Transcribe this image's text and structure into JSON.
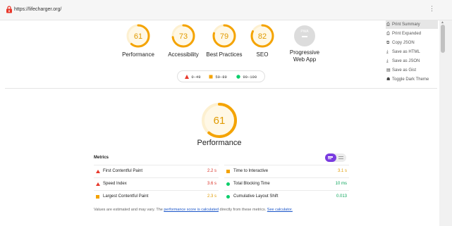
{
  "browser": {
    "url": "https://lifecharger.org/",
    "menu_dots": "⋮"
  },
  "colors": {
    "fail": "#e8382b",
    "average": "#f4a300",
    "pass": "#0cce6b",
    "average_text": "#e09a00",
    "pass_text": "#0ca55b",
    "fail_text": "#d93025",
    "toggle_accent": "#7a3ce0"
  },
  "categories": [
    {
      "label": "Performance",
      "score": 61
    },
    {
      "label": "Accessibility",
      "score": 73
    },
    {
      "label": "Best Practices",
      "score": 79
    },
    {
      "label": "SEO",
      "score": 82
    }
  ],
  "pwa": {
    "badge": "PWA",
    "label_line1": "Progressive",
    "label_line2": "Web App"
  },
  "legend": [
    {
      "icon": "fail-triangle-icon",
      "range": "0–49"
    },
    {
      "icon": "average-square-icon",
      "range": "50–89"
    },
    {
      "icon": "pass-circle-icon",
      "range": "90–100"
    }
  ],
  "main": {
    "score": 61,
    "title": "Performance"
  },
  "metrics": {
    "title": "Metrics",
    "items": [
      {
        "name": "First Contentful Paint",
        "value": "2.2 s",
        "rating": "fail"
      },
      {
        "name": "Time to Interactive",
        "value": "3.1 s",
        "rating": "average"
      },
      {
        "name": "Speed Index",
        "value": "3.6 s",
        "rating": "fail"
      },
      {
        "name": "Total Blocking Time",
        "value": "10 ms",
        "rating": "pass"
      },
      {
        "name": "Largest Contentful Paint",
        "value": "2.3 s",
        "rating": "average"
      },
      {
        "name": "Cumulative Layout Shift",
        "value": "0.013",
        "rating": "pass"
      }
    ]
  },
  "footnote": {
    "prefix": "Values are estimated and may vary. The ",
    "link1": "performance score is calculated",
    "middle": " directly from these metrics. ",
    "link2": "See calculator."
  },
  "menu": {
    "items": [
      {
        "icon": "print-icon",
        "glyph": "⎙",
        "label": "Print Summary"
      },
      {
        "icon": "print-icon",
        "glyph": "⎙",
        "label": "Print Expanded"
      },
      {
        "icon": "copy-icon",
        "glyph": "⧉",
        "label": "Copy JSON"
      },
      {
        "icon": "download-icon",
        "glyph": "⤓",
        "label": "Save as HTML"
      },
      {
        "icon": "download-icon",
        "glyph": "⤓",
        "label": "Save as JSON"
      },
      {
        "icon": "gist-icon",
        "glyph": "▤",
        "label": "Save as Gist"
      },
      {
        "icon": "dark-theme-icon",
        "glyph": "☗",
        "label": "Toggle Dark Theme"
      }
    ]
  }
}
